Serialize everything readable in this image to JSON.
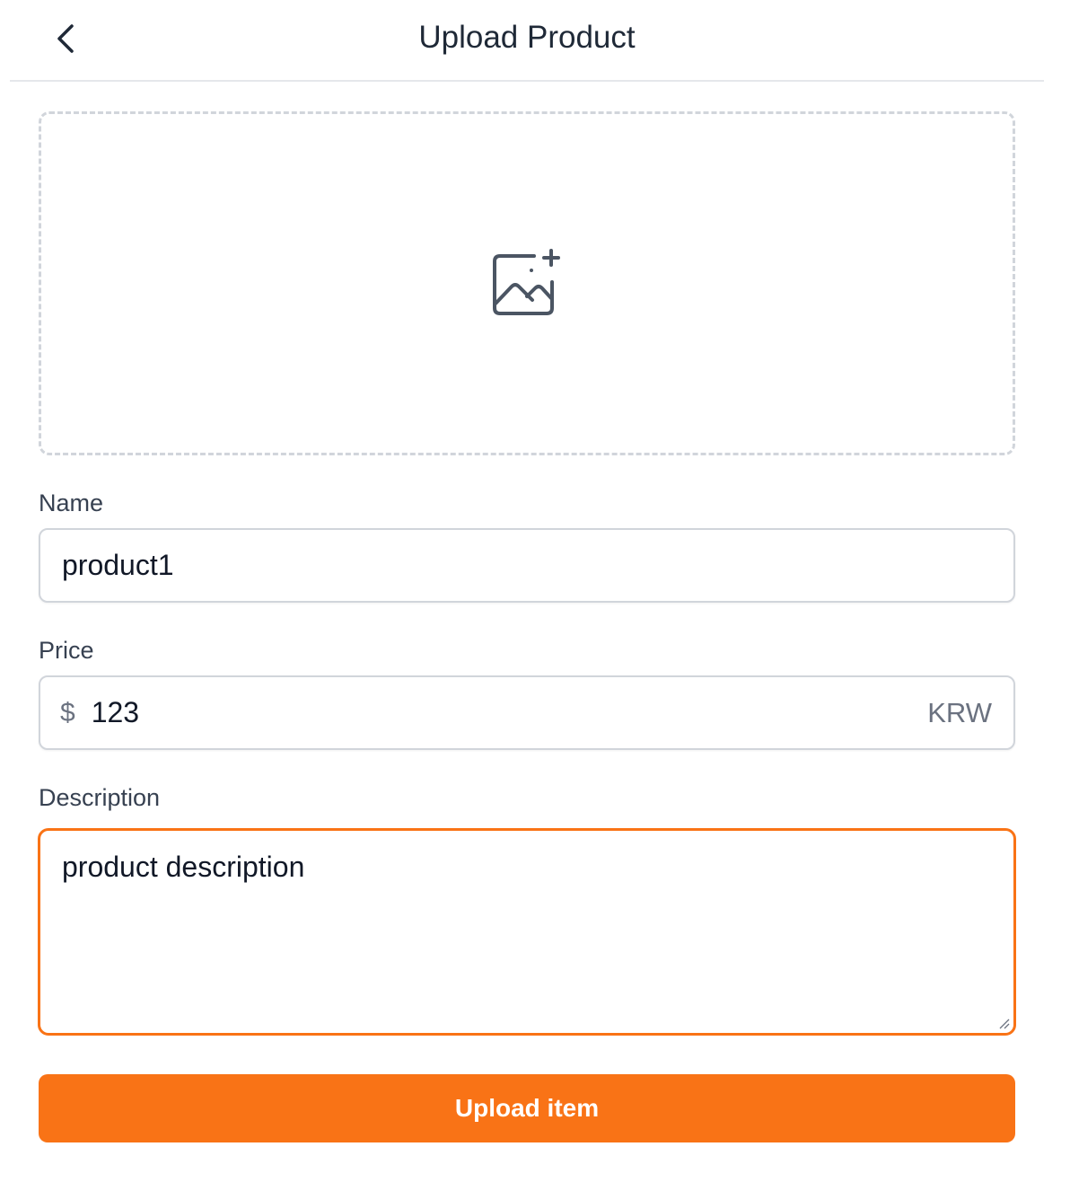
{
  "header": {
    "back_icon": "chevron-left-icon",
    "title": "Upload Product"
  },
  "upload": {
    "icon": "image-add-icon"
  },
  "form": {
    "name_label": "Name",
    "name_value": "product1",
    "price_label": "Price",
    "price_currency_symbol": "$",
    "price_value": "123",
    "price_unit": "KRW",
    "description_label": "Description",
    "description_value": "product description"
  },
  "actions": {
    "submit_label": "Upload item"
  },
  "colors": {
    "accent": "#f97316",
    "border": "#d1d5db",
    "text": "#1f2937",
    "muted": "#6b7280"
  }
}
